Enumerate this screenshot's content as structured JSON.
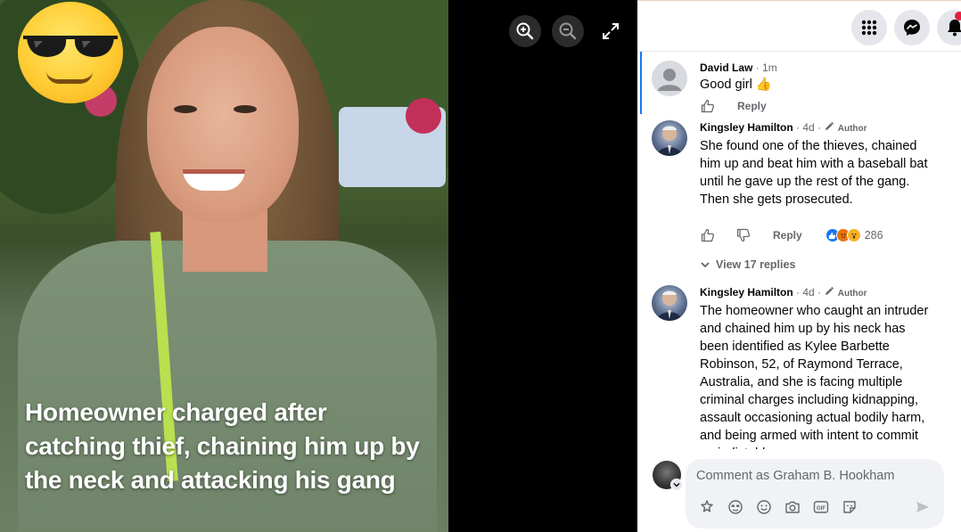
{
  "viewer": {
    "headline": "Homeowner charged after catching thief, chaining him up by the neck and attacking his gang",
    "controls": [
      "zoom-in",
      "zoom-out",
      "fullscreen"
    ]
  },
  "topbar": {
    "icons": [
      "menu-grid-icon",
      "messenger-icon",
      "notifications-icon"
    ]
  },
  "comments": [
    {
      "author": "David Law",
      "time": "1m",
      "text": "Good girl 👍",
      "reply_label": "Reply"
    },
    {
      "author": "Kingsley Hamilton",
      "time": "4d",
      "badge": "Author",
      "text": "She found one of the thieves, chained him up and beat him with a baseball bat until he gave up the rest of the gang. Then she gets prosecuted.",
      "reply_label": "Reply",
      "reaction_count": "286",
      "view_replies": "View 17 replies"
    },
    {
      "author": "Kingsley Hamilton",
      "time": "4d",
      "badge": "Author",
      "text": "The homeowner who caught an intruder and chained him up by his neck has been identified as Kylee Barbette Robinson, 52, of Raymond Terrace, Australia, and she is facing multiple criminal charges including kidnapping, assault occasioning actual bodily harm, and being armed with intent to commit an indictable"
    }
  ],
  "composer": {
    "placeholder": "Comment as Graham B. Hookham"
  },
  "colors": {
    "accent": "#1877f2",
    "muted_text": "#65676b",
    "input_bg": "#f0f2f5"
  }
}
